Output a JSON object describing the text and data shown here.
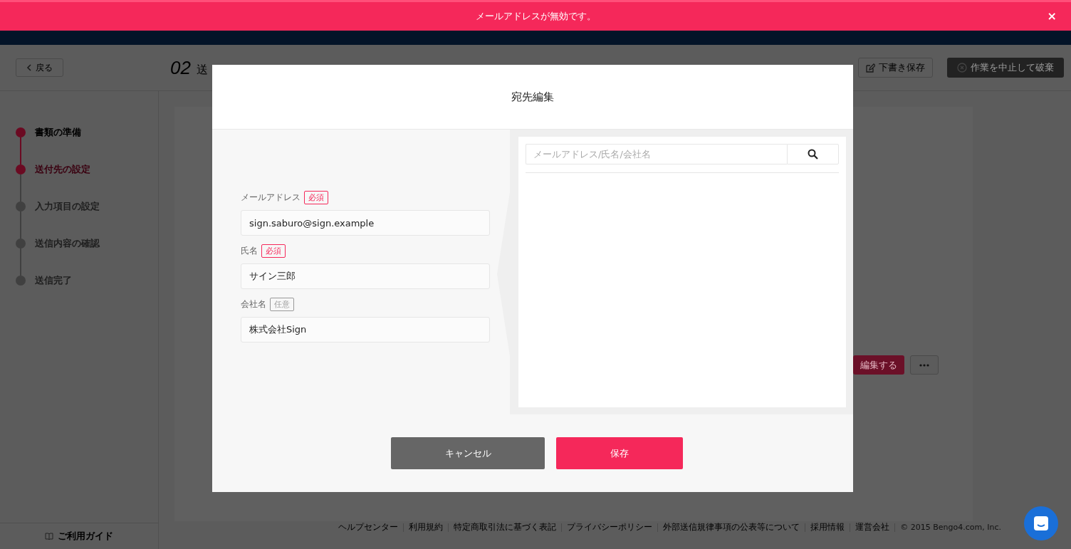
{
  "alert": {
    "message": "メールアドレスが無効です。",
    "close": "×"
  },
  "topbar": {
    "back": "戻る",
    "step_number": "02",
    "title": "送",
    "actions": [
      {
        "label": "下書き保存",
        "kind": "outline"
      },
      {
        "label": "作業を中止して破棄",
        "kind": "dark"
      }
    ]
  },
  "steps": [
    {
      "label": "書類の準備",
      "completed": true,
      "selected": false
    },
    {
      "label": "送付先の設定",
      "completed": false,
      "selected": true
    },
    {
      "label": "入力項目の設定",
      "completed": false,
      "selected": false
    },
    {
      "label": "送信内容の確認",
      "completed": false,
      "selected": false
    },
    {
      "label": "送信完了",
      "completed": false,
      "selected": false
    }
  ],
  "guide": "ご利用ガイド",
  "card": {
    "edit": "編集する"
  },
  "footer": {
    "links": [
      "ヘルプセンター",
      "利用規約",
      "特定商取引法に基づく表記",
      "プライバシーポリシー",
      "外部送信規律事項の公表等について",
      "採用情報",
      "運営会社"
    ],
    "copyright": "© 2015 Bengo4.com, Inc."
  },
  "modal": {
    "title": "宛先編集",
    "fields": [
      {
        "label": "メールアドレス",
        "badge": "必須",
        "required": true,
        "value": "sign.saburo@sign.example"
      },
      {
        "label": "氏名",
        "badge": "必須",
        "required": true,
        "value": "サイン三郎"
      },
      {
        "label": "会社名",
        "badge": "任意",
        "required": false,
        "value": "株式会社Sign"
      }
    ],
    "search": {
      "placeholder": "メールアドレス/氏名/会社名"
    },
    "buttons": [
      {
        "label": "キャンセル",
        "kind": "cancel"
      },
      {
        "label": "保存",
        "kind": "primary"
      }
    ]
  }
}
